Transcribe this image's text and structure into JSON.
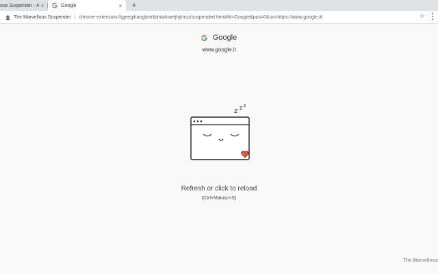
{
  "tabs": [
    {
      "title": "ous Suspender - Abo",
      "active": false
    },
    {
      "title": "Google",
      "active": true
    }
  ],
  "new_tab_label": "+",
  "close_label": "×",
  "omnibox": {
    "extension_name": "The Marvellous Suspender",
    "divider": "|",
    "url": "chrome-extension://gjeegihaogbmilfphilahoiefjhjkncp/suspended.html#ttl=Google&pos=0&uri=https://www.google.it/"
  },
  "star_label": "☆",
  "page": {
    "site_title": "Google",
    "site_url": "www.google.it",
    "reload_text": "Refresh or click to reload",
    "shortcut_text": "(Ctrl+Maiusc+S)",
    "watermark": "The Marvellous"
  },
  "colors": {
    "background": "#f9f9f9",
    "tabstrip": "#dee1e6",
    "heart": "#e8522f"
  }
}
